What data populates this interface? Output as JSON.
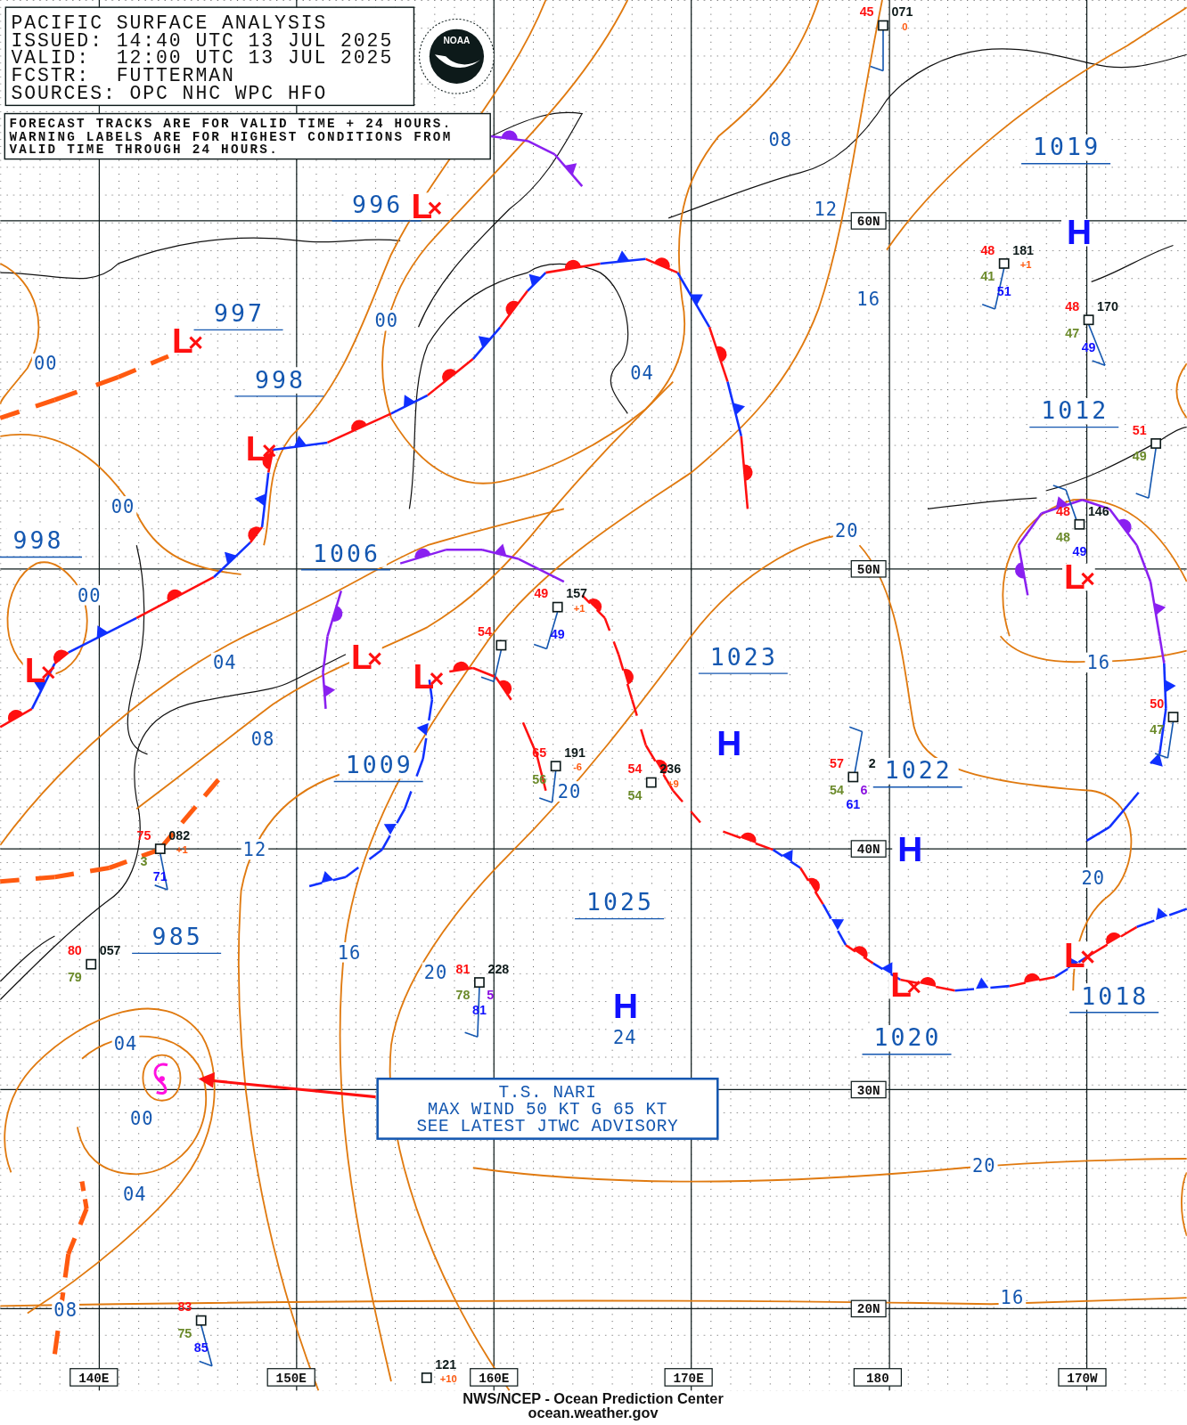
{
  "header": {
    "lines": [
      "PACIFIC SURFACE ANALYSIS",
      "ISSUED: 14:40 UTC 13 JUL 2025",
      "VALID:  12:00 UTC 13 JUL 2025",
      "FCSTR:  FUTTERMAN",
      "SOURCES: OPC NHC WPC HFO"
    ]
  },
  "logo": {
    "text": "NOAA"
  },
  "notice": {
    "lines": [
      "FORECAST TRACKS ARE FOR VALID TIME + 24 HOURS.",
      "WARNING LABELS ARE FOR HIGHEST CONDITIONS FROM",
      "VALID TIME THROUGH 24 HOURS."
    ]
  },
  "latitude_labels": [
    "60N",
    "50N",
    "40N",
    "30N",
    "20N"
  ],
  "longitude_labels": [
    "140E",
    "150E",
    "160E",
    "170E",
    "180",
    "170W"
  ],
  "centers": [
    {
      "kind": "low",
      "symbol": "L"
    },
    {
      "kind": "high",
      "symbol": "H"
    },
    {
      "kind": "low",
      "symbol": "L"
    },
    {
      "kind": "low",
      "symbol": "L"
    },
    {
      "kind": "low",
      "symbol": "L"
    },
    {
      "kind": "low",
      "symbol": "L"
    },
    {
      "kind": "low",
      "symbol": "L"
    },
    {
      "kind": "low",
      "symbol": "L"
    },
    {
      "kind": "high",
      "symbol": "H"
    },
    {
      "kind": "high",
      "symbol": "H"
    },
    {
      "kind": "low",
      "symbol": "L"
    },
    {
      "kind": "low",
      "symbol": "L"
    },
    {
      "kind": "high",
      "symbol": "H"
    }
  ],
  "central_pressures": [
    "1019",
    "996",
    "997",
    "998",
    "1012",
    "998",
    "1006",
    "1023",
    "1009",
    "1022",
    "1025",
    "985",
    "1018",
    "1020"
  ],
  "isobar_labels": [
    "08",
    "12",
    "16",
    "00",
    "00",
    "04",
    "00",
    "20",
    "00",
    "04",
    "16",
    "08",
    "20",
    "12",
    "20",
    "16",
    "20",
    "24",
    "04",
    "00",
    "20",
    "04",
    "16",
    "08"
  ],
  "stations": [
    {
      "fields": [
        {
          "kind": "temperature",
          "text": "45"
        },
        {
          "kind": "pressure",
          "text": "071"
        },
        {
          "kind": "tendency",
          "text": "0"
        }
      ]
    },
    {
      "fields": [
        {
          "kind": "temperature",
          "text": "48"
        },
        {
          "kind": "pressure",
          "text": "181"
        },
        {
          "kind": "tendency",
          "text": "+1"
        },
        {
          "kind": "dewpoint",
          "text": "41"
        },
        {
          "kind": "sea_temp",
          "text": "51"
        }
      ]
    },
    {
      "fields": [
        {
          "kind": "temperature",
          "text": "48"
        },
        {
          "kind": "pressure",
          "text": "170"
        },
        {
          "kind": "dewpoint",
          "text": "47"
        },
        {
          "kind": "sea_temp",
          "text": "49"
        }
      ]
    },
    {
      "fields": [
        {
          "kind": "temperature",
          "text": "51"
        },
        {
          "kind": "dewpoint",
          "text": "49"
        }
      ]
    },
    {
      "fields": [
        {
          "kind": "temperature",
          "text": "48"
        },
        {
          "kind": "pressure",
          "text": "146"
        },
        {
          "kind": "dewpoint",
          "text": "48"
        },
        {
          "kind": "sea_temp",
          "text": "49"
        }
      ]
    },
    {
      "fields": [
        {
          "kind": "temperature",
          "text": "54"
        }
      ]
    },
    {
      "fields": [
        {
          "kind": "temperature",
          "text": "49"
        },
        {
          "kind": "pressure",
          "text": "157"
        },
        {
          "kind": "tendency",
          "text": "+1"
        },
        {
          "kind": "sea_temp",
          "text": "49"
        }
      ]
    },
    {
      "fields": [
        {
          "kind": "temperature",
          "text": "50"
        },
        {
          "kind": "dewpoint",
          "text": "47"
        }
      ]
    },
    {
      "fields": [
        {
          "kind": "temperature",
          "text": "65"
        },
        {
          "kind": "pressure",
          "text": "191"
        },
        {
          "kind": "tendency",
          "text": "-6"
        },
        {
          "kind": "dewpoint",
          "text": "56"
        }
      ]
    },
    {
      "fields": [
        {
          "kind": "temperature",
          "text": "54"
        },
        {
          "kind": "pressure",
          "text": "236"
        },
        {
          "kind": "tendency",
          "text": "+9"
        },
        {
          "kind": "dewpoint",
          "text": "54"
        }
      ]
    },
    {
      "fields": [
        {
          "kind": "temperature",
          "text": "57"
        },
        {
          "kind": "pressure",
          "text": "2"
        },
        {
          "kind": "dewpoint",
          "text": "54"
        },
        {
          "kind": "weather",
          "text": "6"
        },
        {
          "kind": "sea_temp",
          "text": "61"
        }
      ]
    },
    {
      "fields": [
        {
          "kind": "temperature",
          "text": "75"
        },
        {
          "kind": "pressure",
          "text": "082"
        },
        {
          "kind": "tendency",
          "text": "+1"
        },
        {
          "kind": "dewpoint",
          "text": "3"
        },
        {
          "kind": "sea_temp",
          "text": "71"
        }
      ]
    },
    {
      "fields": [
        {
          "kind": "temperature",
          "text": "80"
        },
        {
          "kind": "pressure",
          "text": "057"
        },
        {
          "kind": "dewpoint",
          "text": "79"
        }
      ]
    },
    {
      "fields": [
        {
          "kind": "temperature",
          "text": "81"
        },
        {
          "kind": "pressure",
          "text": "228"
        },
        {
          "kind": "dewpoint",
          "text": "78"
        },
        {
          "kind": "weather",
          "text": "5"
        },
        {
          "kind": "sea_temp",
          "text": "81"
        }
      ]
    },
    {
      "fields": [
        {
          "kind": "temperature",
          "text": "83"
        },
        {
          "kind": "dewpoint",
          "text": "75"
        },
        {
          "kind": "sea_temp",
          "text": "85"
        }
      ]
    },
    {
      "fields": [
        {
          "kind": "pressure",
          "text": "121"
        },
        {
          "kind": "tendency",
          "text": "+10"
        }
      ]
    }
  ],
  "storm_advisory": {
    "lines": [
      "T.S. NARI",
      "MAX WIND 50 KT G 65 KT",
      "SEE LATEST JTWC ADVISORY"
    ]
  },
  "footer": {
    "credit": "NWS/NCEP - Ocean Prediction Center",
    "website": "ocean.weather.gov"
  }
}
